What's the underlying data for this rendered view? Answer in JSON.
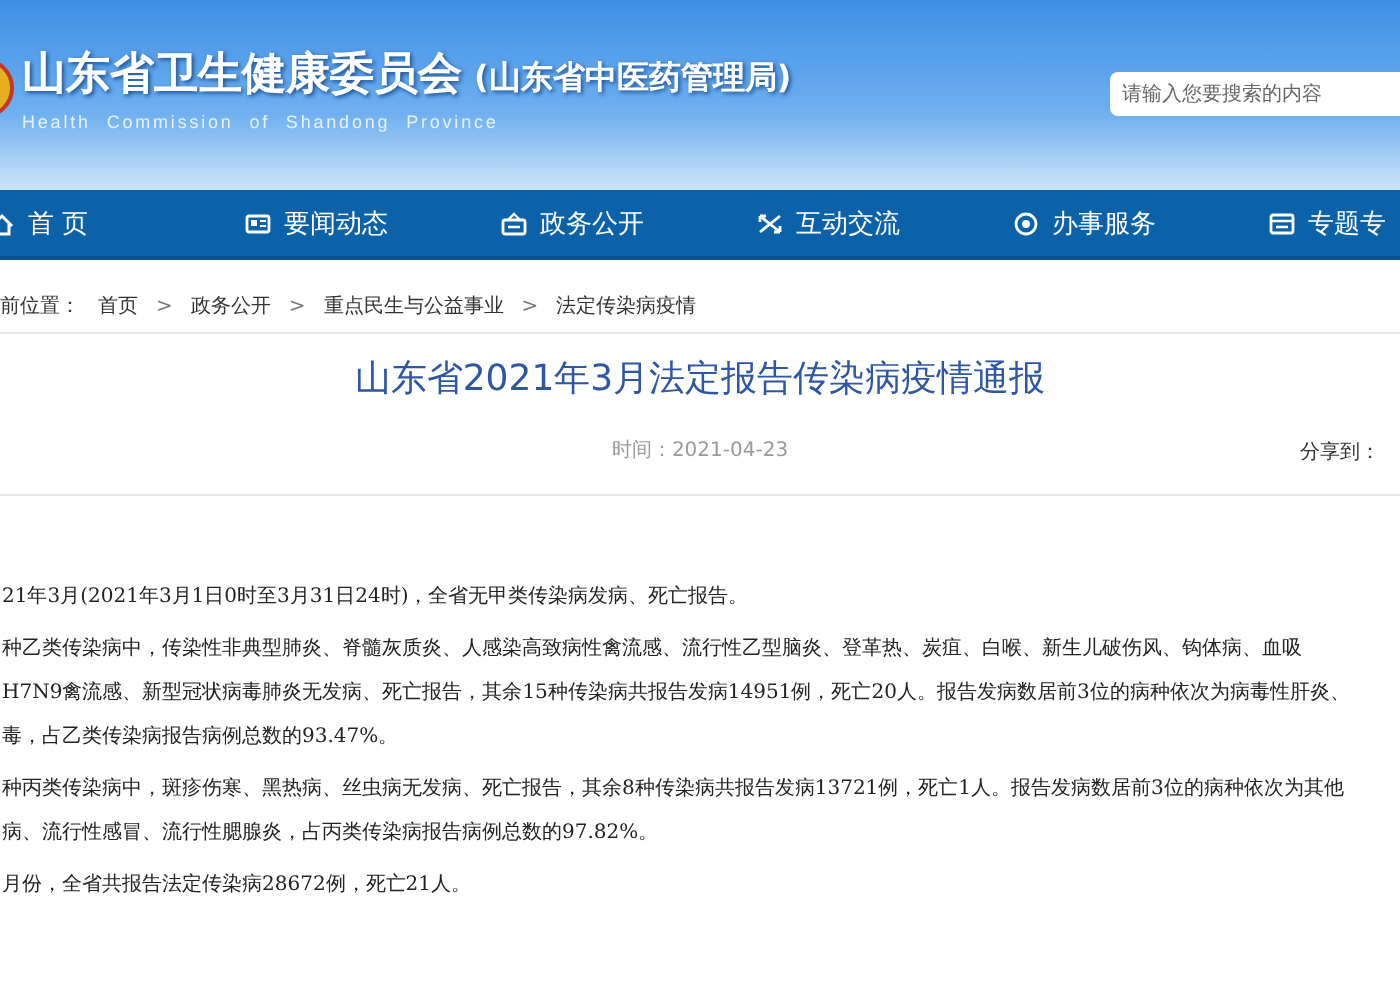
{
  "header": {
    "title": "山东省卫生健康委员会",
    "subtitle": "(山东省中医药管理局)",
    "english": "Health Commission of Shandong Province"
  },
  "search": {
    "placeholder": "请输入您要搜索的内容"
  },
  "nav": [
    {
      "label": "首 页"
    },
    {
      "label": "要闻动态"
    },
    {
      "label": "政务公开"
    },
    {
      "label": "互动交流"
    },
    {
      "label": "办事服务"
    },
    {
      "label": "专题专"
    }
  ],
  "breadcrumb": {
    "label": "前位置：",
    "items": [
      {
        "kind": "link",
        "text": "首页"
      },
      {
        "kind": "sep",
        "text": ">"
      },
      {
        "kind": "link",
        "text": "政务公开"
      },
      {
        "kind": "sep",
        "text": ">"
      },
      {
        "kind": "link",
        "text": "重点民生与公益事业"
      },
      {
        "kind": "sep",
        "text": ">"
      },
      {
        "kind": "link",
        "text": "法定传染病疫情"
      }
    ]
  },
  "article": {
    "title": "山东省2021年3月法定报告传染病疫情通报",
    "time": "时间：2021-04-23",
    "share_label": "分享到：",
    "paragraphs": [
      [
        "21年3月(2021年3月1日0时至3月31日24时)，全省无甲类传染病发病、死亡报告。"
      ],
      [
        "种乙类传染病中，传染性非典型肺炎、脊髓灰质炎、人感染高致病性禽流感、流行性乙型脑炎、登革热、炭疽、白喉、新生儿破伤风、钩体病、血吸",
        "H7N9禽流感、新型冠状病毒肺炎无发病、死亡报告，其余15种传染病共报告发病14951例，死亡20人。报告发病数居前3位的病种依次为病毒性肝炎、",
        "毒，占乙类传染病报告病例总数的93.47%。"
      ],
      [
        "种丙类传染病中，斑疹伤寒、黑热病、丝虫病无发病、死亡报告，其余8种传染病共报告发病13721例，死亡1人。报告发病数居前3位的病种依次为其他",
        "病、流行性感冒、流行性腮腺炎，占丙类传染病报告病例总数的97.82%。"
      ],
      [
        "月份，全省共报告法定传染病28672例，死亡21人。"
      ]
    ]
  }
}
